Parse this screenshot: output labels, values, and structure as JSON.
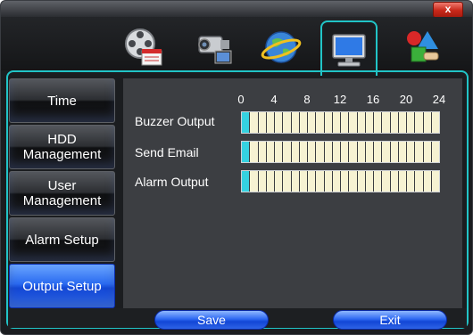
{
  "window": {
    "close_label": "x"
  },
  "tabs": [
    {
      "icon": "film-clapper-icon"
    },
    {
      "icon": "video-camera-icon"
    },
    {
      "icon": "globe-network-icon"
    },
    {
      "icon": "monitor-icon",
      "active": true
    },
    {
      "icon": "tools-shapes-icon"
    }
  ],
  "sidebar": {
    "items": [
      {
        "label": "Time"
      },
      {
        "label": "HDD\nManagement"
      },
      {
        "label": "User\nManagement"
      },
      {
        "label": "Alarm Setup"
      },
      {
        "label": "Output Setup",
        "active": true
      }
    ]
  },
  "schedule": {
    "hour_labels": [
      "0",
      "4",
      "8",
      "12",
      "16",
      "20",
      "24"
    ],
    "rows": [
      {
        "label": "Buzzer Output",
        "selected_cells": [
          0
        ]
      },
      {
        "label": "Send Email",
        "selected_cells": [
          0
        ]
      },
      {
        "label": "Alarm Output",
        "selected_cells": [
          0
        ]
      }
    ],
    "cells_per_row": 24
  },
  "footer": {
    "save_label": "Save",
    "exit_label": "Exit"
  },
  "colors": {
    "accent": "#21c4c7",
    "active_blue": "#2a6af0",
    "selected_cell": "#35d2e0"
  }
}
